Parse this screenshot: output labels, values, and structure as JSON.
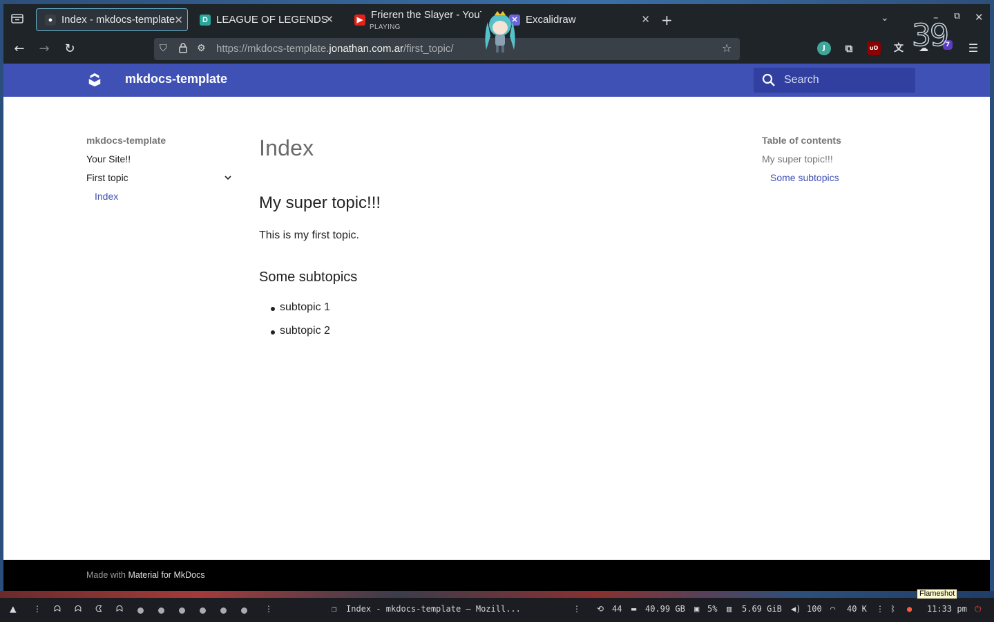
{
  "browser": {
    "tabs": [
      {
        "title": "Index - mkdocs-template",
        "active": true
      },
      {
        "title": "LEAGUE OF LEGENDS O",
        "active": false
      },
      {
        "title": "Frieren the Slayer - YouT",
        "subtitle": "PLAYING",
        "active": false
      },
      {
        "title": "Excalidraw",
        "active": false
      }
    ],
    "url": {
      "prefix": "https://mkdocs-template.",
      "domain": "jonathan.com.ar",
      "path": "/first_topic/"
    },
    "extensions": {
      "profile_letter": "J",
      "ublock_label": "uO",
      "badge_count": "7"
    }
  },
  "site": {
    "name": "mkdocs-template",
    "search_placeholder": "Search",
    "primary_color": "#3f51b5"
  },
  "nav": {
    "title": "mkdocs-template",
    "items": [
      {
        "label": "Your Site!!"
      },
      {
        "label": "First topic",
        "expanded": true
      }
    ],
    "sub_items": [
      {
        "label": "Index",
        "active": true
      }
    ]
  },
  "page": {
    "title": "Index",
    "heading": "My super topic!!!",
    "paragraph": "This is my first topic.",
    "subheading": "Some subtopics",
    "list": [
      "subtopic 1",
      "subtopic 2"
    ]
  },
  "toc": {
    "title": "Table of contents",
    "items": [
      {
        "label": "My super topic!!!"
      },
      {
        "label": "Some subtopics"
      }
    ]
  },
  "footer": {
    "prefix": "Made with ",
    "link": "Material for MkDocs"
  },
  "overlay": {
    "clock_digits": "39"
  },
  "taskbar": {
    "window_title": "Index - mkdocs-template — Mozill...",
    "updates": "44",
    "disk": "40.99 GB",
    "cpu": "5%",
    "ram": "5.69 GiB",
    "volume": "100",
    "net": "40 K",
    "time": "11:33 pm",
    "tooltip": "Flameshot"
  }
}
